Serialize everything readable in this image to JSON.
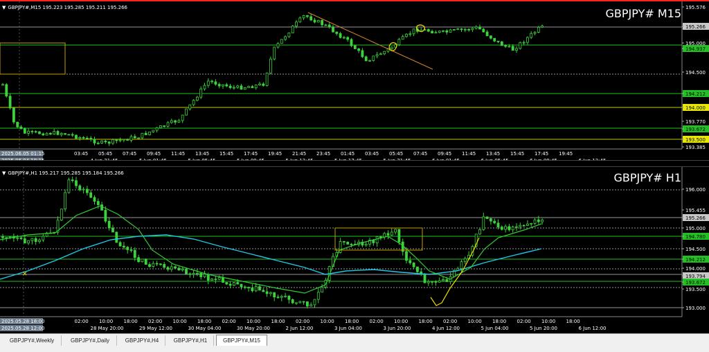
{
  "colors": {
    "up": "#3cd23c",
    "down": "#3cd23c",
    "hline_green": "#22c022",
    "hline_yellow": "#c8c800",
    "ma_fast": "#32cd32",
    "ma_slow": "#1ec8e6",
    "trend": "#d0842a",
    "rect": "#c8a000"
  },
  "m15": {
    "header": "GBPJPY#,M15  195.223 195.285 195.211 195.266",
    "title": "GBPJPY# M15",
    "price_labels": [
      {
        "text": "195.576",
        "style": "plain"
      },
      {
        "text": "195.266",
        "style": "gray"
      },
      {
        "text": "195.000",
        "style": "plain"
      },
      {
        "text": "194.937",
        "style": "green"
      },
      {
        "text": "194.500",
        "style": "plain"
      },
      {
        "text": "194.212",
        "style": "green"
      },
      {
        "text": "194.000",
        "style": "yellow"
      },
      {
        "text": "193.770",
        "style": "plain"
      },
      {
        "text": "193.672",
        "style": "green"
      },
      {
        "text": "193.500",
        "style": "yellow"
      },
      {
        "text": "193.385",
        "style": "plain"
      }
    ],
    "time_row1": [
      "2025.06.05 01:15",
      "03:45",
      "05:45",
      "07:45",
      "09:45",
      "11:45",
      "13:45",
      "15:45",
      "17:45",
      "19:45",
      "21:45",
      "23:45",
      "01:45",
      "03:45",
      "05:45",
      "07:45",
      "09:45",
      "11:45",
      "13:45",
      "15:45",
      "17:45",
      "19:45"
    ],
    "time_row2": [
      "2025.06.04 19:15",
      "4 Jun 21:45",
      "5 Jun 01:45",
      "5 Jun 05:45",
      "5 Jun 09:45",
      "5 Jun 13:45",
      "5 Jun 17:45",
      "5 Jun 21:45",
      "6 Jun 01:45",
      "6 Jun 05:45",
      "6 Jun 09:45",
      "6 Jun 13:45"
    ]
  },
  "h1": {
    "header": "GBPJPY#,H1  195.217 195.285 195.184 195.266",
    "title": "GBPJPY# H1",
    "price_labels": [
      {
        "text": "196.000",
        "style": "plain"
      },
      {
        "text": "195.455",
        "style": "plain"
      },
      {
        "text": "195.266",
        "style": "gray"
      },
      {
        "text": "195.000",
        "style": "plain"
      },
      {
        "text": "194.780",
        "style": "green"
      },
      {
        "text": "194.500",
        "style": "plain"
      },
      {
        "text": "194.212",
        "style": "green"
      },
      {
        "text": "194.000",
        "style": "plain"
      },
      {
        "text": "193.794",
        "style": "gray"
      },
      {
        "text": "193.672",
        "style": "green"
      },
      {
        "text": "193.500",
        "style": "plain"
      },
      {
        "text": "193.000",
        "style": "plain"
      }
    ],
    "time_row1": [
      "2025.05.28 18:00",
      "02:00",
      "10:00",
      "18:00",
      "02:00",
      "10:00",
      "18:00",
      "02:00",
      "10:00",
      "18:00",
      "02:00",
      "10:00",
      "18:00",
      "02:00",
      "10:00",
      "18:00",
      "02:00",
      "10:00",
      "18:00",
      "02:00",
      "10:00",
      "18:00"
    ],
    "time_row2": [
      "2025.05.28 12:00",
      "28 May 20:00",
      "29 May 12:00",
      "30 May 04:00",
      "30 May 20:00",
      "2 Jun 12:00",
      "3 Jun 04:00",
      "3 Jun 20:00",
      "4 Jun 12:00",
      "5 Jun 04:00",
      "5 Jun 20:00",
      "6 Jun 12:00"
    ]
  },
  "tabs": [
    "GBPJPY#,Weekly",
    "GBPJPY#,Daily",
    "GBPJPY#,H4",
    "GBPJPY#,H1",
    "GBPJPY#,M15"
  ],
  "active_tab": "GBPJPY#,M15"
}
